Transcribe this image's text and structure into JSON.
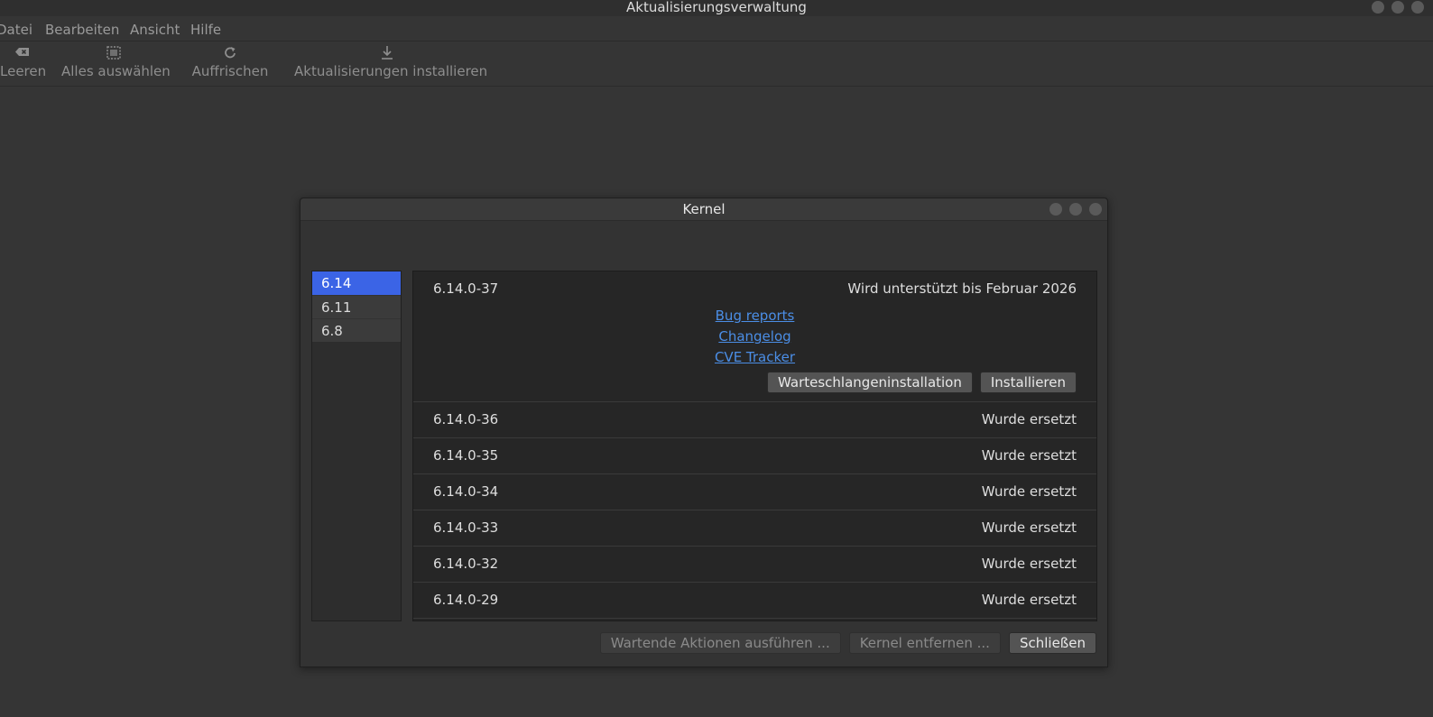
{
  "window": {
    "title": "Aktualisierungsverwaltung"
  },
  "menu": [
    "Datei",
    "Bearbeiten",
    "Ansicht",
    "Hilfe"
  ],
  "toolbar": {
    "clear": {
      "label": "Leeren",
      "icon": "backspace-icon"
    },
    "select_all": {
      "label": "Alles auswählen",
      "icon": "select-all-icon"
    },
    "refresh": {
      "label": "Auffrischen",
      "icon": "refresh-icon"
    },
    "install": {
      "label": "Aktualisierungen installieren",
      "icon": "download-icon"
    }
  },
  "dialog": {
    "title": "Kernel",
    "series": [
      {
        "label": "6.14",
        "selected": true
      },
      {
        "label": "6.11",
        "selected": false
      },
      {
        "label": "6.8",
        "selected": false
      }
    ],
    "expanded_kernel": {
      "version": "6.14.0-37",
      "status": "Wird unterstützt bis Februar 2026",
      "links": [
        "Bug reports",
        "Changelog",
        "CVE Tracker"
      ],
      "queue_button": "Warteschlangeninstallation",
      "install_button": "Installieren"
    },
    "kernels": [
      {
        "version": "6.14.0-36",
        "status": "Wurde ersetzt"
      },
      {
        "version": "6.14.0-35",
        "status": "Wurde ersetzt"
      },
      {
        "version": "6.14.0-34",
        "status": "Wurde ersetzt"
      },
      {
        "version": "6.14.0-33",
        "status": "Wurde ersetzt"
      },
      {
        "version": "6.14.0-32",
        "status": "Wurde ersetzt"
      },
      {
        "version": "6.14.0-29",
        "status": "Wurde ersetzt"
      }
    ],
    "footer": {
      "pending_actions": "Wartende Aktionen ausführen ...",
      "remove_kernel": "Kernel entfernen ...",
      "close": "Schließen"
    }
  }
}
